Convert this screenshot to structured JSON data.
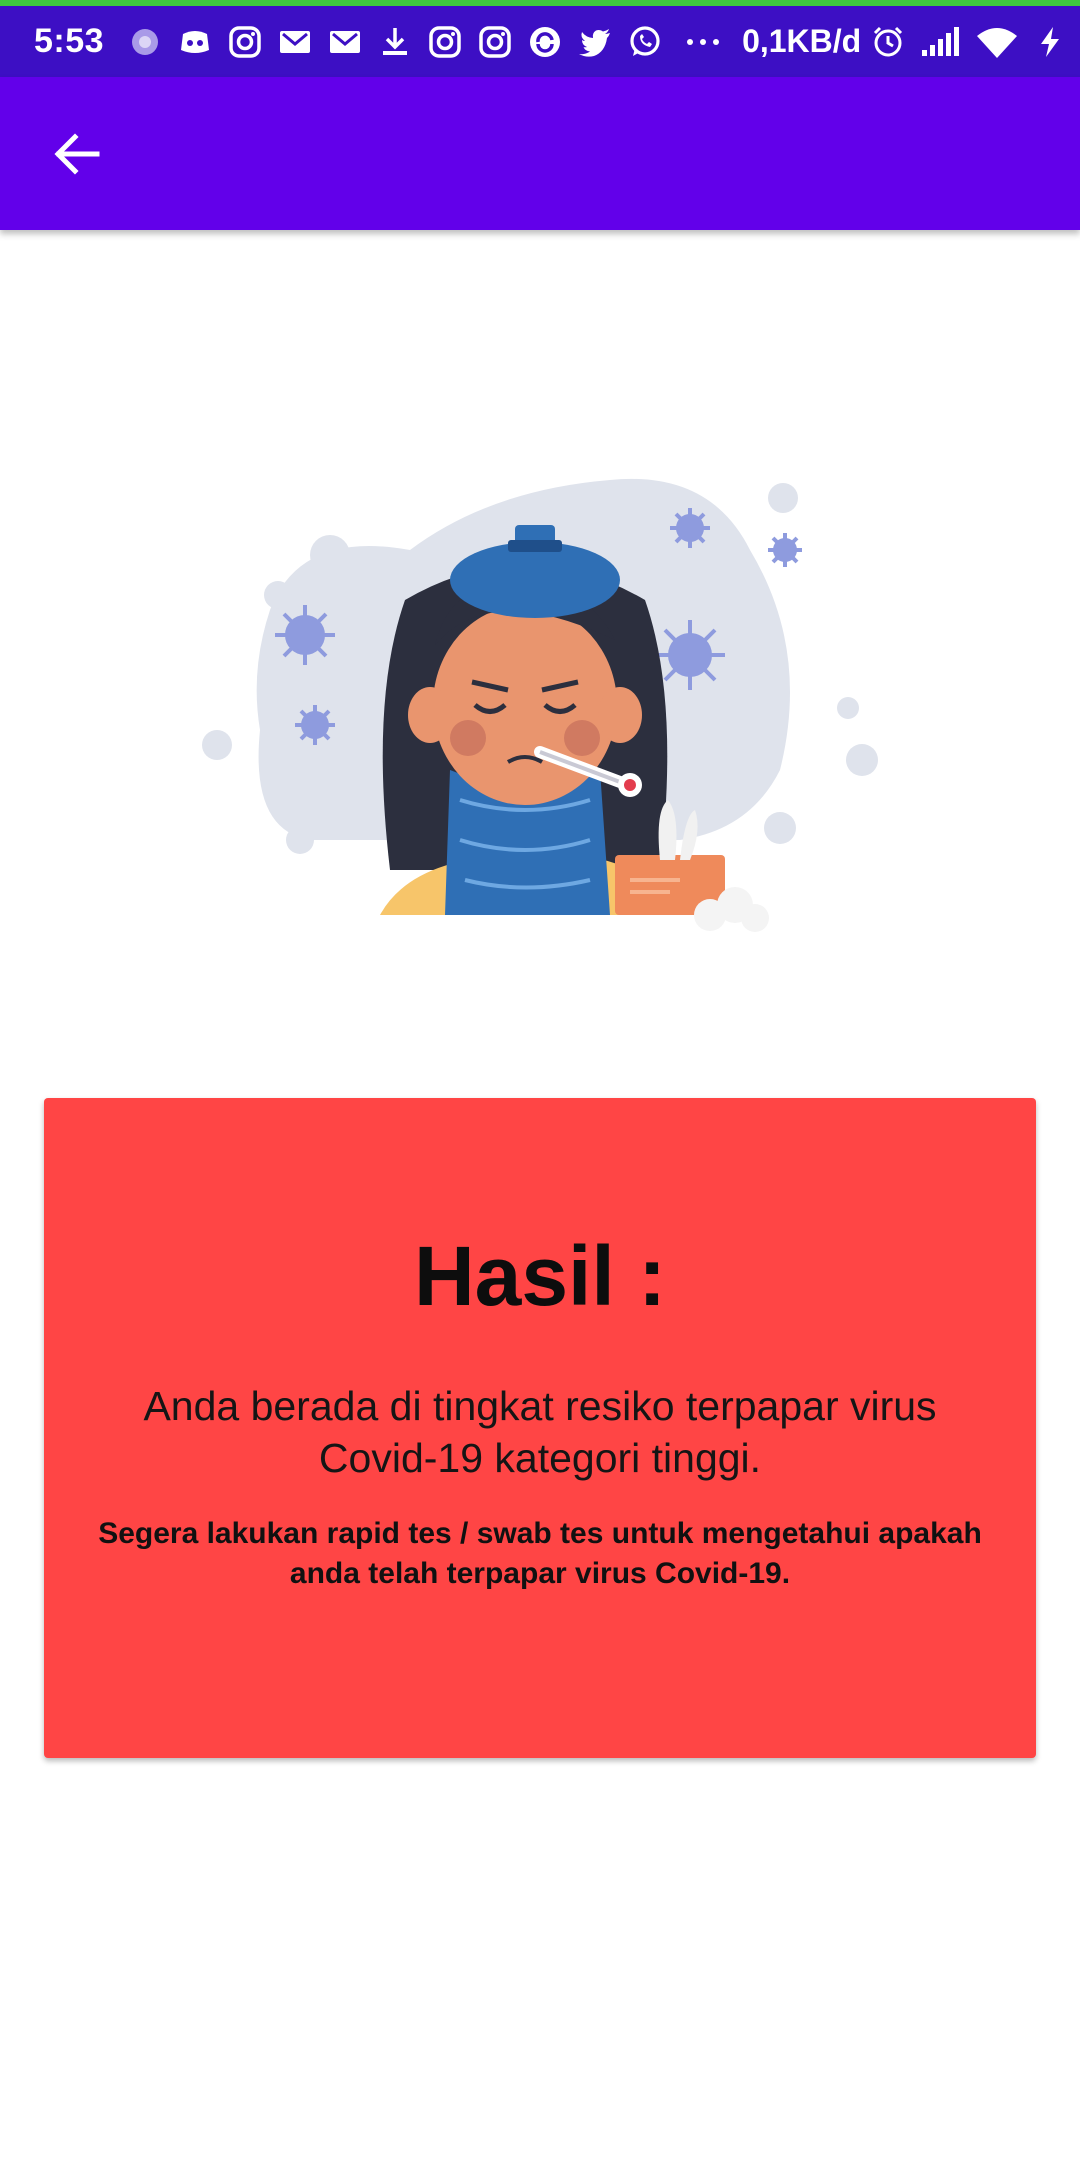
{
  "status_bar": {
    "time": "5:53",
    "net_speed": "0,1KB/d",
    "left_icons": [
      "loading-dots-icon",
      "discord-icon",
      "instagram-icon",
      "gmail-icon",
      "gmail-icon",
      "download-icon",
      "instagram-icon",
      "instagram-icon",
      "sync-icon",
      "twitter-icon",
      "whatsapp-icon",
      "more-dots-icon"
    ],
    "right_icons": [
      "alarm-icon",
      "signal-icon",
      "wifi-icon",
      "charging-icon"
    ],
    "colors": {
      "background": "#3d0fc4",
      "top_line": "#3fc63f"
    }
  },
  "app_bar": {
    "back_icon": "arrow-back-icon",
    "color": "#6200ea"
  },
  "illustration": {
    "icon": "sick-girl-with-thermometer-illustration"
  },
  "result": {
    "title": "Hasil :",
    "message": "Anda berada di tingkat resiko terpapar virus Covid-19 kategori tinggi.",
    "advice": "Segera lakukan rapid tes / swab tes untuk mengetahui apakah anda telah terpapar virus Covid-19.",
    "card_color": "#ff4545"
  }
}
